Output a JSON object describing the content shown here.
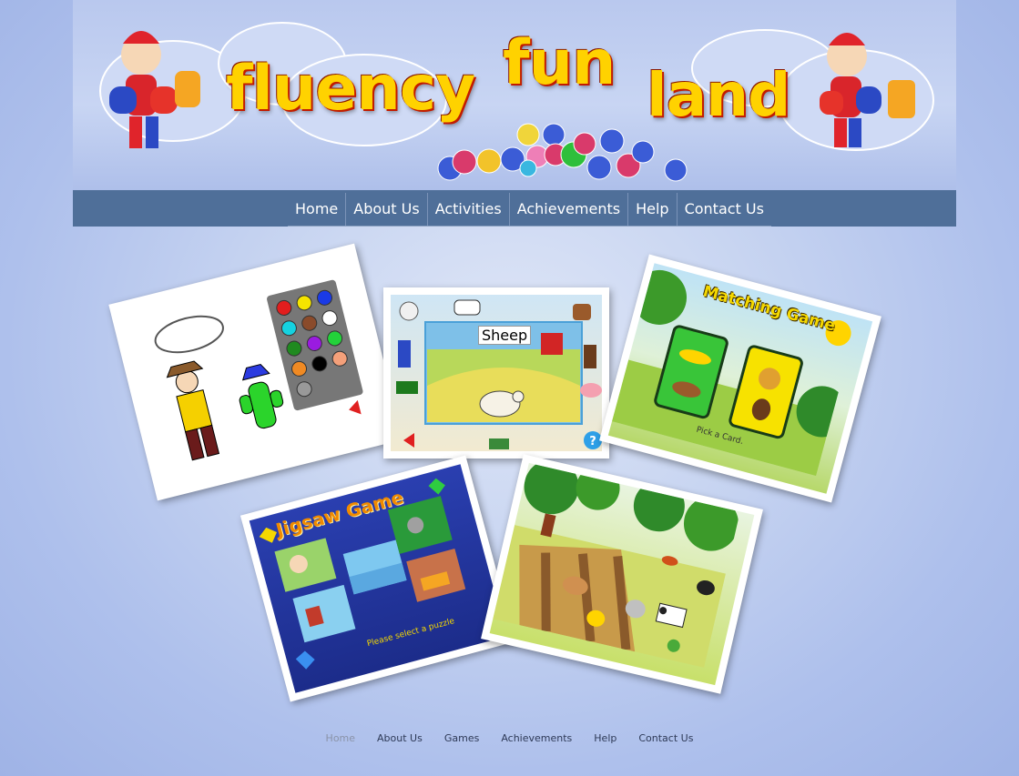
{
  "logo": {
    "word1": "fluency",
    "word2": "fun",
    "word3": "land"
  },
  "nav": {
    "items": [
      {
        "label": "Home"
      },
      {
        "label": "About Us"
      },
      {
        "label": "Activities"
      },
      {
        "label": "Achievements"
      },
      {
        "label": "Help"
      },
      {
        "label": "Contact Us"
      }
    ]
  },
  "gallery": {
    "cards": [
      {
        "name": "coloring-game-thumbnail"
      },
      {
        "name": "farm-animals-game-thumbnail",
        "caption": "Sheep"
      },
      {
        "name": "matching-game-thumbnail",
        "title": "Matching Game",
        "subtitle": "Pick a Card."
      },
      {
        "name": "jigsaw-game-thumbnail",
        "title": "Jigsaw Game",
        "subtitle": "Please select a puzzle"
      },
      {
        "name": "farm-scene-thumbnail"
      }
    ]
  },
  "footer": {
    "items": [
      {
        "label": "Home"
      },
      {
        "label": "About Us"
      },
      {
        "label": "Games"
      },
      {
        "label": "Achievements"
      },
      {
        "label": "Help"
      },
      {
        "label": "Contact Us"
      }
    ]
  },
  "colors": {
    "navbar": "#4f6f99",
    "logo_fill": "#ffd200",
    "logo_outline": "#c21b00",
    "footer_active": "#8a93a8"
  }
}
